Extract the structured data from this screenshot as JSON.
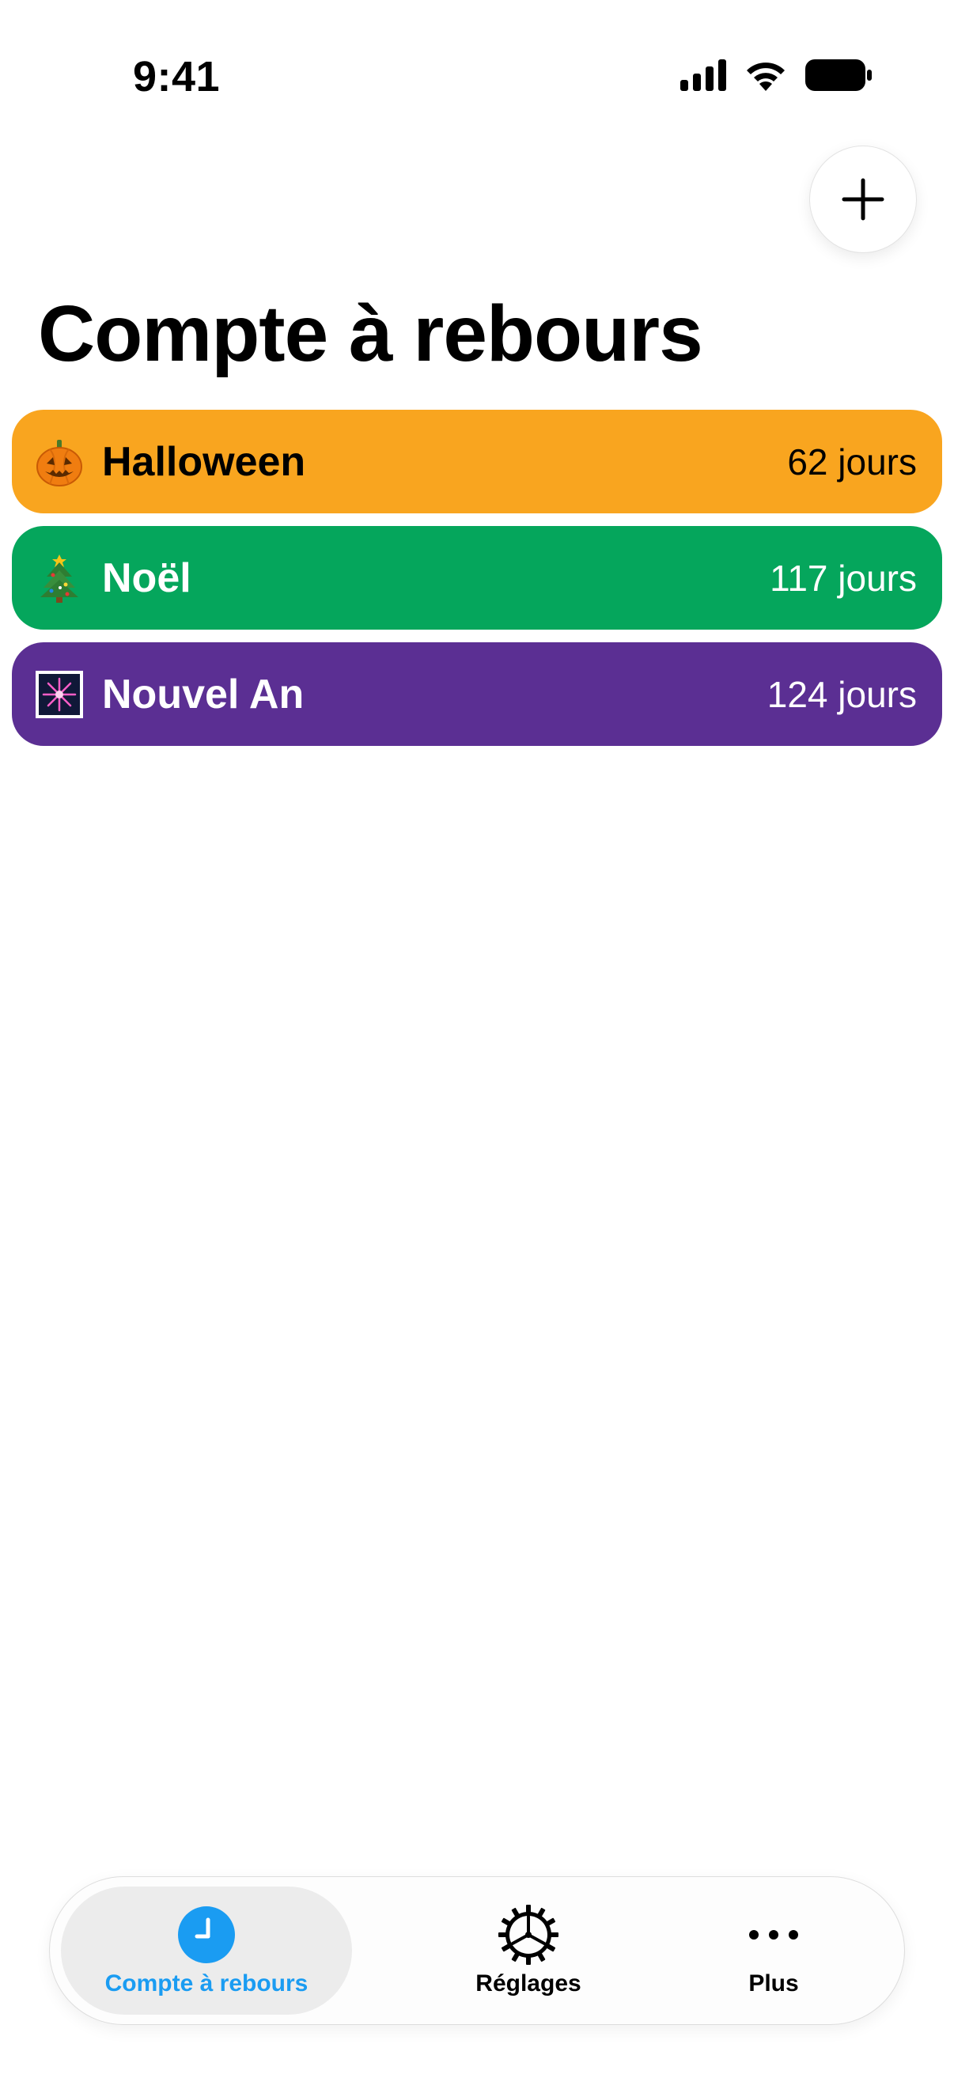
{
  "status_bar": {
    "time": "9:41"
  },
  "header": {
    "add_icon": "plus-icon",
    "title": "Compte à rebours"
  },
  "countdowns": [
    {
      "name": "Halloween",
      "days": "62 jours",
      "icon": "jack-o-lantern-icon",
      "color": "#F9A51F",
      "text_color": "#000000"
    },
    {
      "name": "Noël",
      "days": "117 jours",
      "icon": "christmas-tree-icon",
      "color": "#05A65C",
      "text_color": "#FFFFFF"
    },
    {
      "name": "Nouvel An",
      "days": "124 jours",
      "icon": "fireworks-icon",
      "color": "#5B2F93",
      "text_color": "#FFFFFF"
    }
  ],
  "tab_bar": {
    "tabs": [
      {
        "label": "Compte à rebours",
        "icon": "clock-icon",
        "active": true,
        "color": "#1A9CF2"
      },
      {
        "label": "Réglages",
        "icon": "gear-icon",
        "active": false,
        "color": "#000000"
      },
      {
        "label": "Plus",
        "icon": "more-icon",
        "active": false,
        "color": "#000000"
      }
    ]
  }
}
